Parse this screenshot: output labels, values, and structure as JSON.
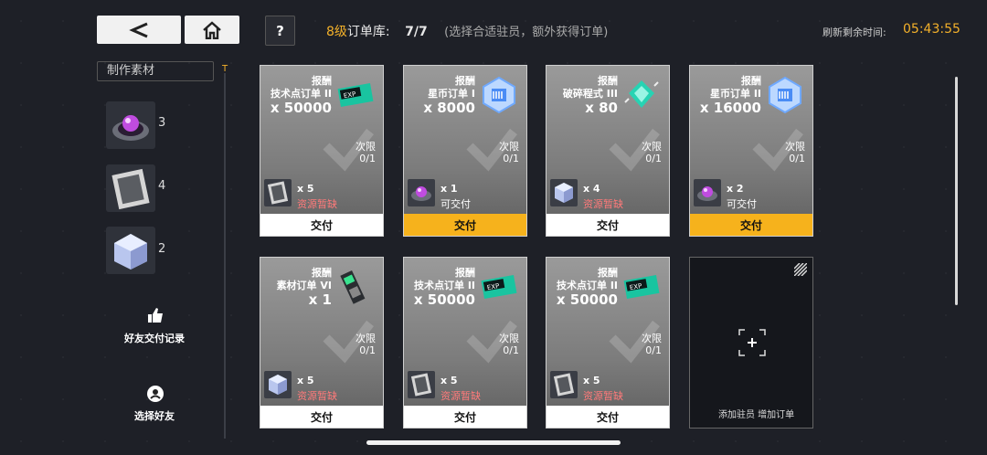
{
  "header": {
    "level": "8级",
    "library_label": "订单库:",
    "count": "7/7",
    "hint": "(选择合适驻员，额外获得订单)",
    "refresh_label": "刷新剩余时间:",
    "refresh_time": "05:43:55"
  },
  "sidebar": {
    "title": "制作素材",
    "materials": [
      {
        "icon": "purple-crystal-disk-icon",
        "count": "3"
      },
      {
        "icon": "grey-material-card-icon",
        "count": "4"
      },
      {
        "icon": "ice-cube-icon",
        "count": "2"
      }
    ],
    "friend_record_label": "好友交付记录",
    "select_friend_label": "选择好友"
  },
  "cards": [
    {
      "reward_label": "报酬",
      "order_name": "技术点订单 II",
      "qty": "x 50000",
      "reward_icon": "exp-ticket-icon",
      "limit_label": "次限",
      "limit": "0/1",
      "req_icon": "grey-material-card-icon",
      "req_qty": "x 5",
      "status": "资源暂缺",
      "status_type": "short",
      "deliver": "交付",
      "active": false
    },
    {
      "reward_label": "报酬",
      "order_name": "星币订单 I",
      "qty": "x 8000",
      "reward_icon": "star-coin-icon",
      "limit_label": "次限",
      "limit": "0/1",
      "req_icon": "purple-crystal-disk-icon",
      "req_qty": "x 1",
      "status": "可交付",
      "status_type": "ok",
      "deliver": "交付",
      "active": true
    },
    {
      "reward_label": "报酬",
      "order_name": "破碎程式 III",
      "qty": "x 80",
      "reward_icon": "broken-program-icon",
      "limit_label": "次限",
      "limit": "0/1",
      "req_icon": "ice-cube-icon",
      "req_qty": "x 4",
      "status": "资源暂缺",
      "status_type": "short",
      "deliver": "交付",
      "active": false
    },
    {
      "reward_label": "报酬",
      "order_name": "星币订单 II",
      "qty": "x 16000",
      "reward_icon": "star-coin-icon",
      "limit_label": "次限",
      "limit": "0/1",
      "req_icon": "purple-crystal-disk-icon",
      "req_qty": "x 2",
      "status": "可交付",
      "status_type": "ok",
      "deliver": "交付",
      "active": true
    },
    {
      "reward_label": "报酬",
      "order_name": "素材订单 VI",
      "qty": "x 1",
      "reward_icon": "material-module-icon",
      "limit_label": "次限",
      "limit": "0/1",
      "req_icon": "ice-cube-icon",
      "req_qty": "x 5",
      "status": "资源暂缺",
      "status_type": "short",
      "deliver": "交付",
      "active": false
    },
    {
      "reward_label": "报酬",
      "order_name": "技术点订单 II",
      "qty": "x 50000",
      "reward_icon": "exp-ticket-icon",
      "limit_label": "次限",
      "limit": "0/1",
      "req_icon": "grey-material-card-icon",
      "req_qty": "x 5",
      "status": "资源暂缺",
      "status_type": "short",
      "deliver": "交付",
      "active": false
    },
    {
      "reward_label": "报酬",
      "order_name": "技术点订单 II",
      "qty": "x 50000",
      "reward_icon": "exp-ticket-icon",
      "limit_label": "次限",
      "limit": "0/1",
      "req_icon": "grey-material-card-icon",
      "req_qty": "x 5",
      "status": "资源暂缺",
      "status_type": "short",
      "deliver": "交付",
      "active": false
    }
  ],
  "add_card": {
    "label": "添加驻员 增加订单"
  },
  "colors": {
    "accent": "#f6b21c",
    "shortage": "#ff7a7a",
    "background": "#1e2027"
  }
}
